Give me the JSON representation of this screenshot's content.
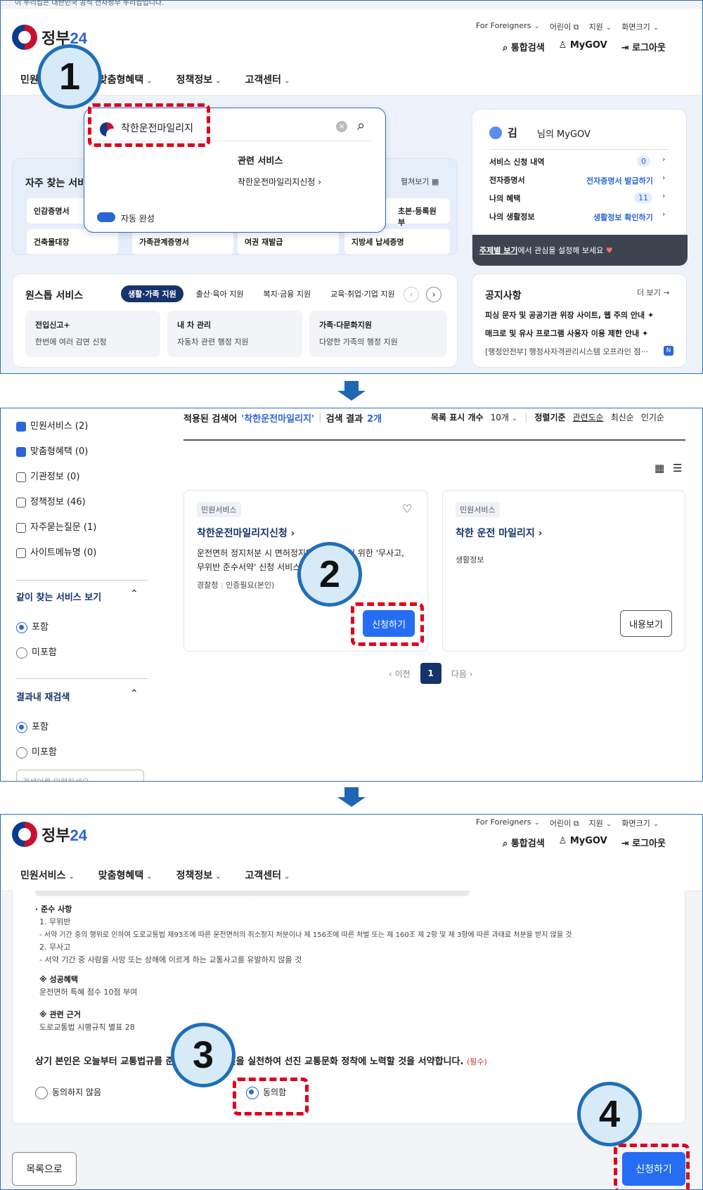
{
  "brand": {
    "name_kr": "정부",
    "name_num": "24"
  },
  "util": {
    "foreigners": "For Foreigners",
    "kids": "어린이",
    "support": "지원",
    "screen": "화면크기"
  },
  "quick": {
    "search": "통합검색",
    "mygov": "MyGOV",
    "logout": "로그아웃"
  },
  "gnb": [
    "민원서비스",
    "맞춤형혜택",
    "정책정보",
    "고객센터"
  ],
  "top_notice": "이 누리집은 대한민국 공식 전자정부 누리집입니다.",
  "panel1": {
    "search_value": "착한운전마일리지",
    "related_title": "관련 서비스",
    "related_item": "착한운전마일리지신청",
    "autocomplete": "자동 완성",
    "freq_title": "자주 찾는 서비스",
    "freq_more": "펼쳐보기",
    "freq_items": [
      "인감증명서",
      "건축물대장",
      "가족관계증명서",
      "여권 재발급",
      "지방세 납세증명",
      "초본·등록원부"
    ],
    "mygov": {
      "name": "김",
      "suffix": "님의 MyGOV",
      "rows": [
        {
          "label": "서비스 신청 내역",
          "value": "0"
        },
        {
          "label": "전자증명서",
          "value": "전자증명서 발급하기"
        },
        {
          "label": "나의 혜택",
          "value": "11"
        },
        {
          "label": "나의 생활정보",
          "value": "생활정보 확인하기"
        }
      ],
      "banner_bold": "주제별 보기",
      "banner_rest": "에서 관심을 설정해 보세요"
    },
    "onestop": {
      "title": "원스톱 서비스",
      "tabs": [
        "생활·가족 지원",
        "출산·육아 지원",
        "복지·금융 지원",
        "교육·취업·기업 지원"
      ],
      "cards": [
        {
          "title": "전입신고+",
          "desc": "한번에 여러 감면 신청"
        },
        {
          "title": "내 차 관리",
          "desc": "자동차 관련 행정 지원"
        },
        {
          "title": "가족·다문화지원",
          "desc": "다양한 가족의 행정 지원"
        }
      ]
    },
    "notice": {
      "title": "공지사항",
      "more": "더 보기",
      "items": [
        "피싱 문자 및 공공기관 위장 사이트, 웹 주의 안내",
        "매크로 및 유사 프로그램 사용자 이용 제한 안내",
        "[행정안전부] 행정사자격관리시스템 오프라인 점···"
      ],
      "new_badge": "N"
    }
  },
  "panel2": {
    "filters": [
      {
        "label": "민원서비스 (2)",
        "checked": true
      },
      {
        "label": "맞춤형혜택 (0)",
        "checked": true
      },
      {
        "label": "기관정보 (0)",
        "checked": false
      },
      {
        "label": "정책정보 (46)",
        "checked": false
      },
      {
        "label": "자주묻는질문 (1)",
        "checked": false
      },
      {
        "label": "사이트메뉴명 (0)",
        "checked": false
      }
    ],
    "together_title": "같이 찾는 서비스 보기",
    "include": "포함",
    "exclude": "미포함",
    "research_title": "결과내 재검색",
    "research_placeholder": "검색어를 입력하세요",
    "applied_label": "적용된 검색어",
    "applied_term": "'착한운전마일리지'",
    "result_label": "검색 결과",
    "result_count": "2개",
    "list_count_label": "목록 표시 개수",
    "list_count": "10개",
    "sort_label": "정렬기준",
    "sort_opts": [
      "관련도순",
      "최신순",
      "인기순"
    ],
    "result1": {
      "tag": "민원서비스",
      "title": "착한운전마일리지신청",
      "desc1": "운전면허 정지처분 시 면허정지일을 감면받기 위한 '무사고,",
      "desc2": "무위반 준수서약' 신청 서비스입니다",
      "meta1": "경찰청",
      "meta2": "인증필요(본인)",
      "btn": "신청하기"
    },
    "result2": {
      "tag": "민원서비스",
      "title": "착한 운전 마일리지",
      "desc": "생활정보",
      "btn": "내용보기"
    },
    "pager": {
      "prev": "이전",
      "page": "1",
      "next": "다음"
    }
  },
  "panel3": {
    "heading": "준수 사항",
    "l1": "1. 무위반",
    "l2": "- 서약 기간 중의 행위로 인하여 도로교통법 제93조에 따른 운전면허의 취소정지 처분이나 제 156조에 따른 처벌 또는 제 160조 제 2항 및 제 3항에 따른 과태료 처분을 받지 않을 것",
    "l3": "2. 무사고",
    "l4": "- 서약 기간 중 사람을 사망 또는 상해에 이르게 하는 교통사고를 유발하지 않을 것",
    "benefit_title": "※ 성공혜택",
    "benefit": "운전면허 특혜 점수 10점 부여",
    "basis_title": "※ 관련 근거",
    "basis": "도로교통법 시행규칙 별표 28",
    "pledge": "상기 본인은 오늘부터 교통법규를 준수하고 안전운전을 실천하여 선진 교통문화 정착에 노력할 것을 서약합니다.",
    "required": "(필수)",
    "disagree": "동의하지 않음",
    "agree": "동의함",
    "back": "목록으로",
    "submit": "신청하기"
  },
  "steps": [
    "1",
    "2",
    "3",
    "4"
  ]
}
